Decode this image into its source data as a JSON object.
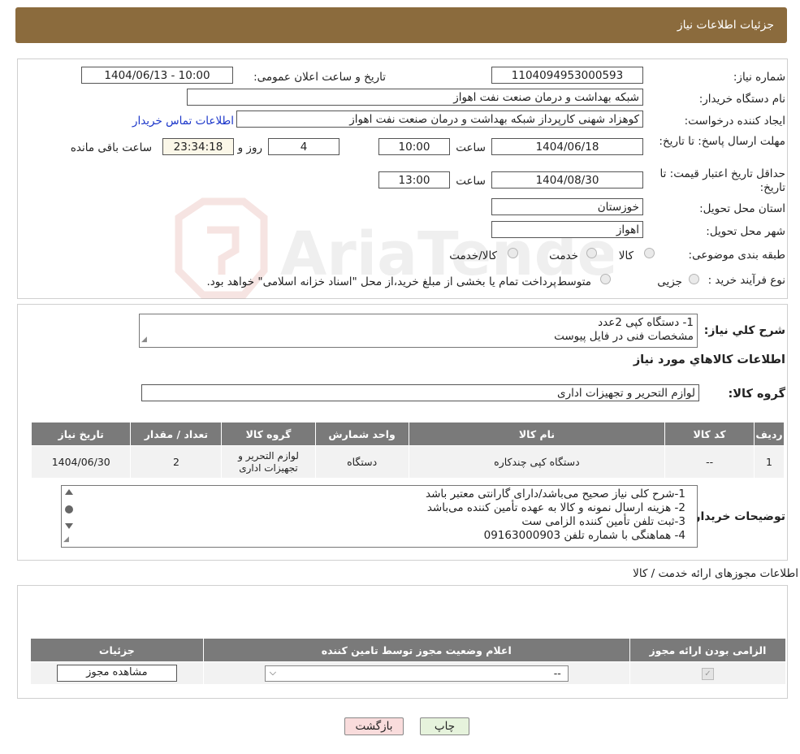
{
  "header": {
    "title": "جزئیات اطلاعات نیاز"
  },
  "watermark": {
    "text": "AriaTender.neT"
  },
  "form": {
    "need_number_label": "شماره نیاز:",
    "need_number": "1104094953000593",
    "announce_label": "تاریخ و ساعت اعلان عمومی:",
    "announce_value": "1404/06/13 - 10:00",
    "buyer_label": "نام دستگاه خریدار:",
    "buyer_value": "شبکه بهداشت و درمان صنعت نفت اهواز",
    "creator_label": "ایجاد کننده درخواست:",
    "creator_value": "کوهزاد شهنی کارپرداز شبکه بهداشت و درمان صنعت نفت اهواز",
    "contact_link": "اطلاعات تماس خریدار",
    "deadline_label": "مهلت ارسال پاسخ: تا تاریخ:",
    "deadline_date": "1404/06/18",
    "hour_label": "ساعت",
    "deadline_time": "10:00",
    "days_value": "4",
    "days_label": "روز و",
    "remaining_time": "23:34:18",
    "remaining_label": "ساعت باقی مانده",
    "validity_label": "حداقل تاریخ اعتبار قیمت: تا تاریخ:",
    "validity_date": "1404/08/30",
    "validity_time": "13:00",
    "province_label": "استان محل تحویل:",
    "province_value": "خوزستان",
    "city_label": "شهر محل تحویل:",
    "city_value": "اهواز",
    "category_label": "طبقه بندی موضوعی:",
    "category_options": [
      "کالا",
      "خدمت",
      "کالا/خدمت"
    ],
    "process_label": "نوع فرآیند خرید :",
    "process_options": [
      "جزیی",
      "متوسط"
    ],
    "process_note": "پرداخت تمام یا بخشی از مبلغ خرید،از محل \"اسناد خزانه اسلامی\" خواهد بود."
  },
  "summary": {
    "label": "شرح کلي نياز:",
    "lines": [
      "1- دستگاه کپی 2عدد",
      "مشخصات فنی در فایل پیوست"
    ]
  },
  "goods": {
    "section_title": "اطلاعات کالاهاي مورد نياز",
    "group_label": "گروه کالا:",
    "group_value": "لوازم التحرير و تجهيزات اداری",
    "columns": [
      "ردیف",
      "کد کالا",
      "نام کالا",
      "واحد شمارش",
      "گروه کالا",
      "تعداد / مقدار",
      "تاریخ نیاز"
    ],
    "rows": [
      {
        "row": "1",
        "code": "--",
        "name": "دستگاه کپی چندکاره",
        "unit": "دستگاه",
        "group": "لوازم التحریر و تجهیزات اداری",
        "qty": "2",
        "date": "1404/06/30"
      }
    ]
  },
  "buyer_notes": {
    "label": "توضیحات خریدار:",
    "lines": [
      "1-شرح کلی نیاز صحیح می‌باشد/دارای گارانتی معتبر باشد",
      "2- هزینه ارسال نمونه و کالا به عهده تأمین کننده می‌باشد",
      "3-ثبت تلفن تأمین کننده الزامی ست",
      "4- هماهنگی با شماره تلفن 09163000903"
    ]
  },
  "permits": {
    "section_title": "اطلاعات مجوزهای ارائه خدمت / کالا",
    "columns": [
      "الزامی بودن ارائه مجوز",
      "اعلام وضعیت مجوز توسط تامین کننده",
      "جزئیات"
    ],
    "select_value": "--",
    "view_button": "مشاهده مجوز"
  },
  "footer": {
    "print_label": "چاپ",
    "back_label": "بازگشت"
  }
}
